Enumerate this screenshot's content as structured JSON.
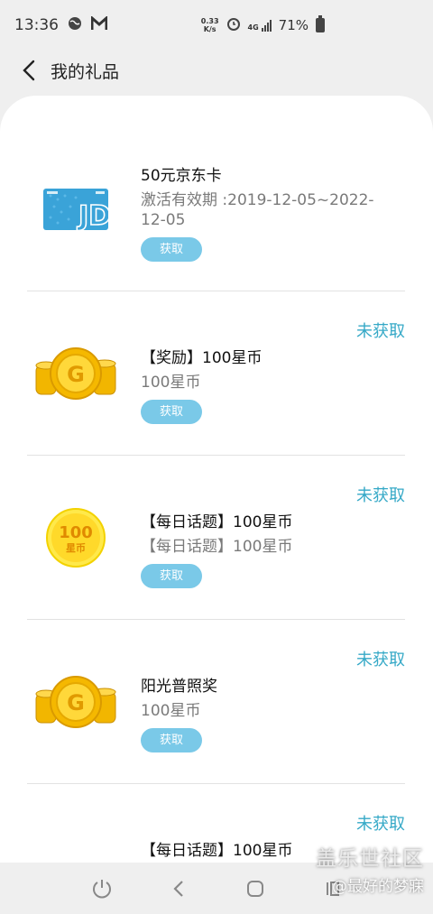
{
  "status_bar": {
    "time": "13:36",
    "speed_value": "0.33",
    "speed_unit": "K/s",
    "battery": "71%",
    "network": "4G"
  },
  "header": {
    "title": "我的礼品"
  },
  "gifts": [
    {
      "title": "50元京东卡",
      "desc": "激活有效期 :2019-12-05~2022-12-05",
      "status": "",
      "button": "获取",
      "icon": "jd-card-icon"
    },
    {
      "title": "【奖励】100星币",
      "desc": "100星币",
      "status": "未获取",
      "button": "获取",
      "icon": "gold-coins-icon"
    },
    {
      "title": "【每日话题】100星币",
      "desc": "【每日话题】100星币",
      "status": "未获取",
      "button": "获取",
      "icon": "star-coin-icon",
      "coin_value": "100",
      "coin_unit": "星币"
    },
    {
      "title": "阳光普照奖",
      "desc": "100星币",
      "status": "未获取",
      "button": "获取",
      "icon": "gold-coins-icon"
    },
    {
      "title": "【每日话题】100星币",
      "desc": "",
      "status": "未获取",
      "button": "",
      "icon": "star-coin-icon"
    }
  ],
  "jd_card": {
    "brand": "JD"
  },
  "watermark": {
    "line1": "盖乐世社区",
    "line2": "@最好的梦寐"
  },
  "colors": {
    "accent": "#36a9c7",
    "button": "#7ac9e8",
    "coin": "#f5c518"
  }
}
